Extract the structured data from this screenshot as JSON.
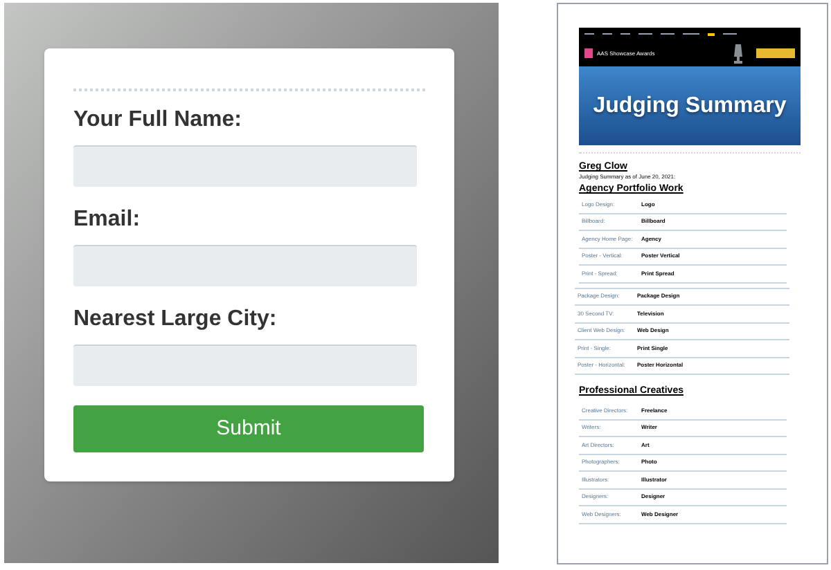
{
  "form": {
    "fields": [
      {
        "label": "Your Full Name:"
      },
      {
        "label": "Email:"
      },
      {
        "label": "Nearest Large City:"
      }
    ],
    "submit": "Submit"
  },
  "document": {
    "banner": {
      "brand": "AAS Showcase Awards",
      "title": "Judging Summary"
    },
    "name": "Greg Clow",
    "date_line": "Judging Summary as of June 20, 2021:",
    "sections": [
      {
        "heading": "Agency Portfolio Work",
        "rows": [
          {
            "label": "Logo Design:",
            "value": "Logo"
          },
          {
            "label": "Billboard:",
            "value": "Billboard"
          },
          {
            "label": "Agency Home Page:",
            "value": "Agency"
          },
          {
            "label": "Poster - Vertical:",
            "value": "Poster Vertical"
          },
          {
            "label": "Print - Spread:",
            "value": "Print Spread"
          }
        ]
      },
      {
        "rows": [
          {
            "label": "Package Design:",
            "value": "Package Design"
          },
          {
            "label": "30 Second TV:",
            "value": "Television"
          },
          {
            "label": "Client Web Design:",
            "value": "Web Design"
          },
          {
            "label": "Print - Single:",
            "value": "Print Single"
          },
          {
            "label": "Poster - Horizontal:",
            "value": "Poster Horizontal"
          }
        ]
      },
      {
        "heading": "Professional Creatives",
        "rows": [
          {
            "label": "Creative Directors:",
            "value": "Freelance"
          },
          {
            "label": "Writers:",
            "value": "Writer"
          },
          {
            "label": "Art Directors:",
            "value": "Art"
          },
          {
            "label": "Photographers:",
            "value": "Photo"
          },
          {
            "label": "Illustrators:",
            "value": "Illustrator"
          },
          {
            "label": "Designers:",
            "value": "Designer"
          },
          {
            "label": "Web Designers:",
            "value": "Web Designer"
          }
        ]
      }
    ]
  }
}
